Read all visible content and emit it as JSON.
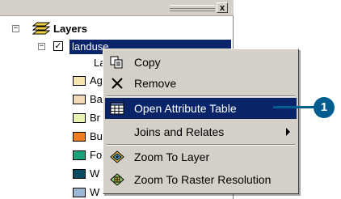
{
  "toc": {
    "close_glyph": "x",
    "root_label": "Layers",
    "root_expander": "−",
    "layer": {
      "expander": "−",
      "checked": true,
      "name": "landuse",
      "legend_header": "La"
    },
    "legend": [
      {
        "label": "Ag",
        "color": "#f5e6b0"
      },
      {
        "label": "Ba",
        "color": "#f2d9b8"
      },
      {
        "label": "Br",
        "color": "#e9f2b0"
      },
      {
        "label": "Bu",
        "color": "#ee7d1f"
      },
      {
        "label": "Fo",
        "color": "#19a37a"
      },
      {
        "label": "W",
        "color": "#0b4a63"
      },
      {
        "label": "W",
        "color": "#9ab8d6"
      }
    ]
  },
  "context_menu": {
    "items": [
      {
        "label": "Copy",
        "icon": "copy-icon"
      },
      {
        "label": "Remove",
        "icon": "remove-icon"
      },
      {
        "label": "Open Attribute Table",
        "icon": "table-icon",
        "highlighted": true
      },
      {
        "label": "Joins and Relates",
        "icon": "",
        "has_submenu": true
      },
      {
        "label": "Zoom To Layer",
        "icon": "zoom-to-layer-icon"
      },
      {
        "label": "Zoom To Raster Resolution",
        "icon": "zoom-raster-icon"
      }
    ]
  },
  "callout": {
    "number": "1",
    "color": "#005d8f"
  },
  "colors": {
    "selection": "#0a246a",
    "panel": "#d4d0c8"
  }
}
